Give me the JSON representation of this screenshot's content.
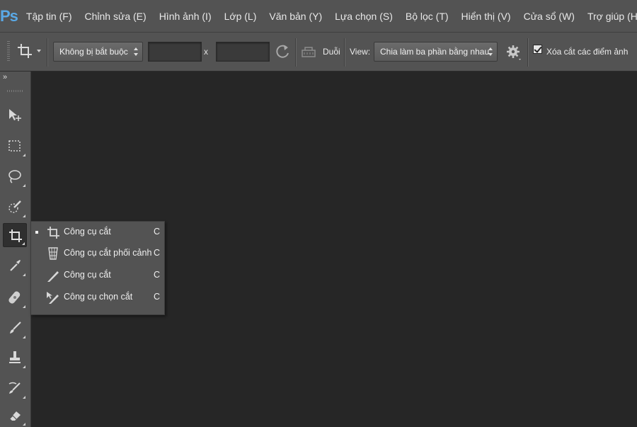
{
  "app": {
    "logo": "Ps"
  },
  "menu": [
    "Tập tin (F)",
    "Chỉnh sửa (E)",
    "Hình ảnh (I)",
    "Lớp (L)",
    "Văn bản (Y)",
    "Lựa chọn (S)",
    "Bộ lọc (T)",
    "Hiển thị (V)",
    "Cửa sổ (W)",
    "Trợ giúp (H)"
  ],
  "options": {
    "tool_icon": "crop-icon",
    "ratio_select": "Không bị bắt buộc",
    "width_value": "",
    "height_value": "",
    "x_separator": "x",
    "straighten_label": "Duỗi",
    "view_label": "View:",
    "view_select": "Chia làm ba phần bằng nhau",
    "delete_cropped_label": "Xóa cắt các điểm ảnh",
    "delete_cropped_checked": true
  },
  "toolbar": {
    "collapse": "»",
    "tools": [
      {
        "name": "move-tool",
        "icon": "move-icon"
      },
      {
        "name": "marquee-tool",
        "icon": "rect-marquee-icon"
      },
      {
        "name": "lasso-tool",
        "icon": "lasso-icon"
      },
      {
        "name": "quick-select-tool",
        "icon": "quick-select-icon"
      },
      {
        "name": "crop-tool",
        "icon": "crop-icon",
        "active": true
      },
      {
        "name": "eyedropper-tool",
        "icon": "eyedropper-icon"
      },
      {
        "name": "healing-tool",
        "icon": "bandage-icon"
      },
      {
        "name": "brush-tool",
        "icon": "brush-icon"
      },
      {
        "name": "stamp-tool",
        "icon": "stamp-icon"
      },
      {
        "name": "history-brush-tool",
        "icon": "history-brush-icon"
      },
      {
        "name": "eraser-tool",
        "icon": "eraser-icon"
      }
    ]
  },
  "flyout": {
    "items": [
      {
        "label": "Công cụ cắt",
        "shortcut": "C",
        "icon": "crop-icon",
        "selected": true
      },
      {
        "label": "Công cụ cắt phối cảnh",
        "shortcut": "C",
        "icon": "perspective-crop-icon",
        "selected": false
      },
      {
        "label": "Công cụ cắt",
        "shortcut": "C",
        "icon": "slice-icon",
        "selected": false
      },
      {
        "label": "Công cụ chọn cắt",
        "shortcut": "C",
        "icon": "slice-select-icon",
        "selected": false
      }
    ]
  },
  "colors": {
    "ui_bg": "#535353",
    "canvas_bg": "#262626",
    "logo": "#5aa9e6"
  }
}
